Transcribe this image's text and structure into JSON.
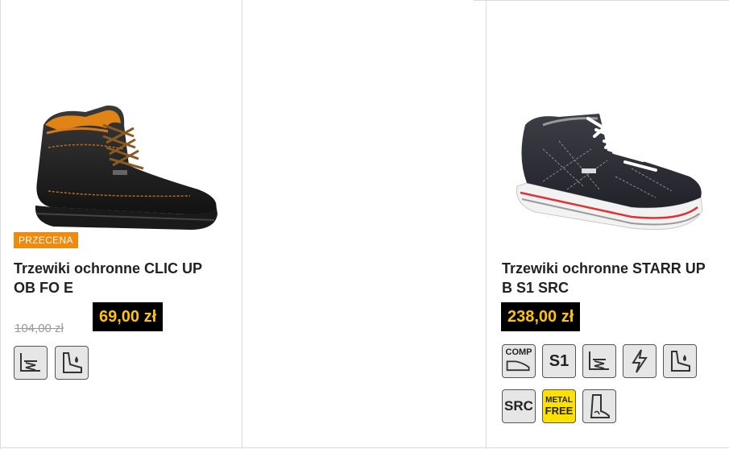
{
  "products": [
    {
      "badge": "PRZECENA",
      "title_line1": "Trzewiki ochronne CLIC UP",
      "title_line2": "OB FO E",
      "price": "69,00 zł",
      "old_price": "104,00 zł",
      "icons": [
        "shock-absorb-icon",
        "water-resistant-icon"
      ]
    },
    {
      "title_line1": "Trzewiki ochronne STARR UP",
      "title_line2": "B S1 SRC",
      "price": "238,00 zł",
      "icons_row1": [
        "composite-toecap-icon",
        "s1-icon",
        "shock-absorb-icon",
        "antistatic-icon",
        "water-resistant-icon"
      ],
      "icon_labels": {
        "comp": "COMP",
        "s1": "S1",
        "src": "SRC",
        "metal_free_1": "METAL",
        "metal_free_2": "FREE"
      },
      "icons_row2": [
        "src-icon",
        "metal-free-icon",
        "boot-icon"
      ]
    }
  ],
  "colors": {
    "badge": "#ef8a0c",
    "price_bg": "#000000",
    "price_text": "#ffc400",
    "metal_free_bg": "#ffe100"
  }
}
